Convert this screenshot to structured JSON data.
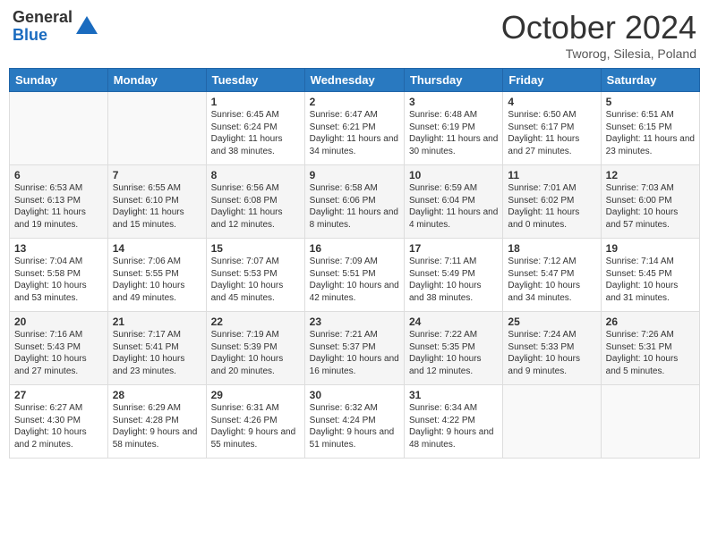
{
  "header": {
    "logo_general": "General",
    "logo_blue": "Blue",
    "month_title": "October 2024",
    "location": "Tworog, Silesia, Poland"
  },
  "weekdays": [
    "Sunday",
    "Monday",
    "Tuesday",
    "Wednesday",
    "Thursday",
    "Friday",
    "Saturday"
  ],
  "weeks": [
    [
      {
        "day": "",
        "content": ""
      },
      {
        "day": "",
        "content": ""
      },
      {
        "day": "1",
        "content": "Sunrise: 6:45 AM\nSunset: 6:24 PM\nDaylight: 11 hours and 38 minutes."
      },
      {
        "day": "2",
        "content": "Sunrise: 6:47 AM\nSunset: 6:21 PM\nDaylight: 11 hours and 34 minutes."
      },
      {
        "day": "3",
        "content": "Sunrise: 6:48 AM\nSunset: 6:19 PM\nDaylight: 11 hours and 30 minutes."
      },
      {
        "day": "4",
        "content": "Sunrise: 6:50 AM\nSunset: 6:17 PM\nDaylight: 11 hours and 27 minutes."
      },
      {
        "day": "5",
        "content": "Sunrise: 6:51 AM\nSunset: 6:15 PM\nDaylight: 11 hours and 23 minutes."
      }
    ],
    [
      {
        "day": "6",
        "content": "Sunrise: 6:53 AM\nSunset: 6:13 PM\nDaylight: 11 hours and 19 minutes."
      },
      {
        "day": "7",
        "content": "Sunrise: 6:55 AM\nSunset: 6:10 PM\nDaylight: 11 hours and 15 minutes."
      },
      {
        "day": "8",
        "content": "Sunrise: 6:56 AM\nSunset: 6:08 PM\nDaylight: 11 hours and 12 minutes."
      },
      {
        "day": "9",
        "content": "Sunrise: 6:58 AM\nSunset: 6:06 PM\nDaylight: 11 hours and 8 minutes."
      },
      {
        "day": "10",
        "content": "Sunrise: 6:59 AM\nSunset: 6:04 PM\nDaylight: 11 hours and 4 minutes."
      },
      {
        "day": "11",
        "content": "Sunrise: 7:01 AM\nSunset: 6:02 PM\nDaylight: 11 hours and 0 minutes."
      },
      {
        "day": "12",
        "content": "Sunrise: 7:03 AM\nSunset: 6:00 PM\nDaylight: 10 hours and 57 minutes."
      }
    ],
    [
      {
        "day": "13",
        "content": "Sunrise: 7:04 AM\nSunset: 5:58 PM\nDaylight: 10 hours and 53 minutes."
      },
      {
        "day": "14",
        "content": "Sunrise: 7:06 AM\nSunset: 5:55 PM\nDaylight: 10 hours and 49 minutes."
      },
      {
        "day": "15",
        "content": "Sunrise: 7:07 AM\nSunset: 5:53 PM\nDaylight: 10 hours and 45 minutes."
      },
      {
        "day": "16",
        "content": "Sunrise: 7:09 AM\nSunset: 5:51 PM\nDaylight: 10 hours and 42 minutes."
      },
      {
        "day": "17",
        "content": "Sunrise: 7:11 AM\nSunset: 5:49 PM\nDaylight: 10 hours and 38 minutes."
      },
      {
        "day": "18",
        "content": "Sunrise: 7:12 AM\nSunset: 5:47 PM\nDaylight: 10 hours and 34 minutes."
      },
      {
        "day": "19",
        "content": "Sunrise: 7:14 AM\nSunset: 5:45 PM\nDaylight: 10 hours and 31 minutes."
      }
    ],
    [
      {
        "day": "20",
        "content": "Sunrise: 7:16 AM\nSunset: 5:43 PM\nDaylight: 10 hours and 27 minutes."
      },
      {
        "day": "21",
        "content": "Sunrise: 7:17 AM\nSunset: 5:41 PM\nDaylight: 10 hours and 23 minutes."
      },
      {
        "day": "22",
        "content": "Sunrise: 7:19 AM\nSunset: 5:39 PM\nDaylight: 10 hours and 20 minutes."
      },
      {
        "day": "23",
        "content": "Sunrise: 7:21 AM\nSunset: 5:37 PM\nDaylight: 10 hours and 16 minutes."
      },
      {
        "day": "24",
        "content": "Sunrise: 7:22 AM\nSunset: 5:35 PM\nDaylight: 10 hours and 12 minutes."
      },
      {
        "day": "25",
        "content": "Sunrise: 7:24 AM\nSunset: 5:33 PM\nDaylight: 10 hours and 9 minutes."
      },
      {
        "day": "26",
        "content": "Sunrise: 7:26 AM\nSunset: 5:31 PM\nDaylight: 10 hours and 5 minutes."
      }
    ],
    [
      {
        "day": "27",
        "content": "Sunrise: 6:27 AM\nSunset: 4:30 PM\nDaylight: 10 hours and 2 minutes."
      },
      {
        "day": "28",
        "content": "Sunrise: 6:29 AM\nSunset: 4:28 PM\nDaylight: 9 hours and 58 minutes."
      },
      {
        "day": "29",
        "content": "Sunrise: 6:31 AM\nSunset: 4:26 PM\nDaylight: 9 hours and 55 minutes."
      },
      {
        "day": "30",
        "content": "Sunrise: 6:32 AM\nSunset: 4:24 PM\nDaylight: 9 hours and 51 minutes."
      },
      {
        "day": "31",
        "content": "Sunrise: 6:34 AM\nSunset: 4:22 PM\nDaylight: 9 hours and 48 minutes."
      },
      {
        "day": "",
        "content": ""
      },
      {
        "day": "",
        "content": ""
      }
    ]
  ]
}
